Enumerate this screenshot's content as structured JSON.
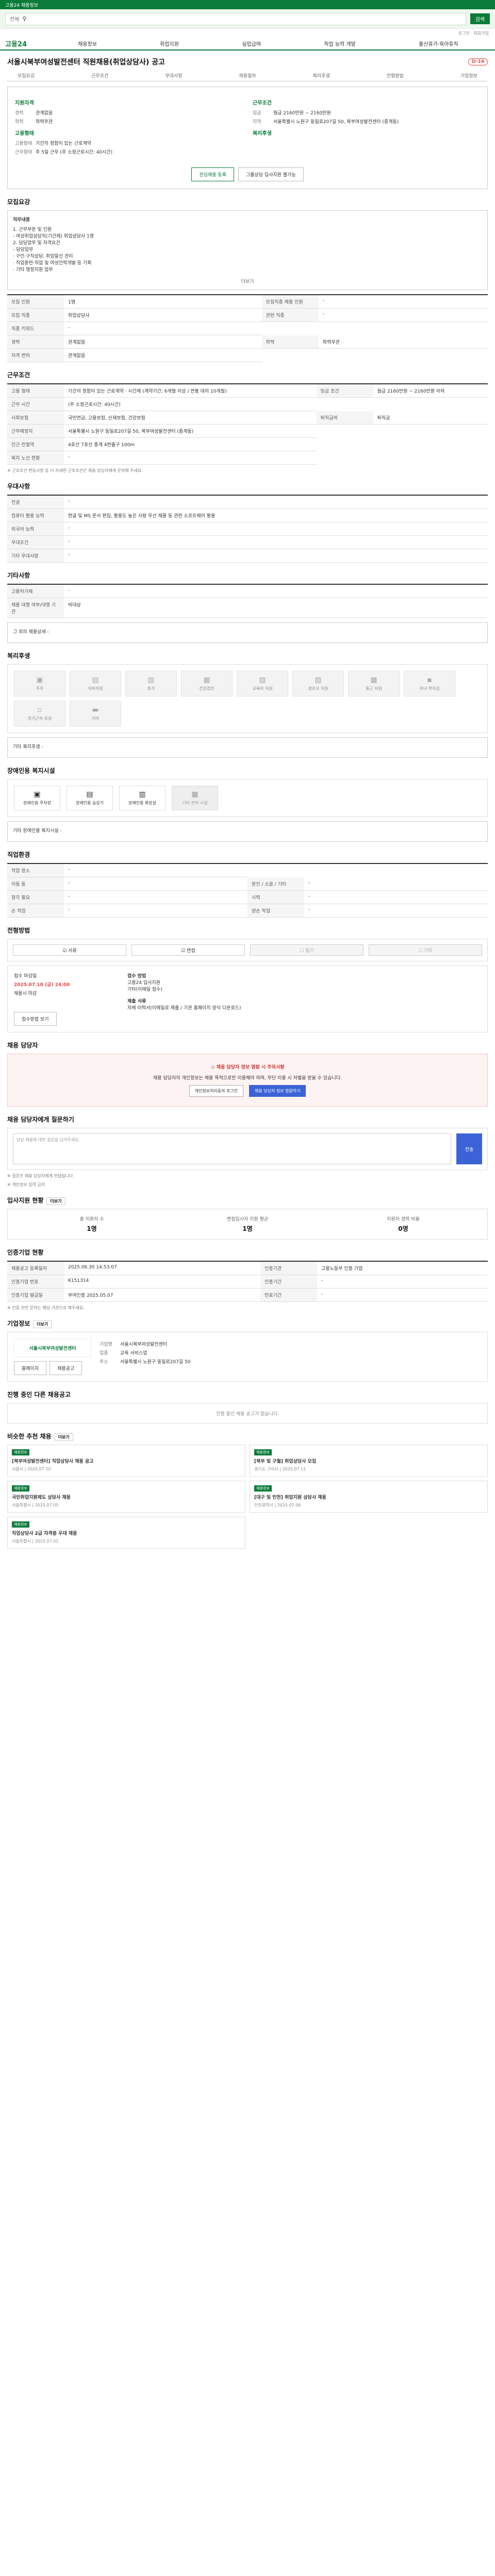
{
  "topbar": {
    "text": "고용24 채용정보"
  },
  "search": {
    "scope": "전체",
    "button": "검색"
  },
  "util": {
    "login": "로그인",
    "signup": "회원가입"
  },
  "gnb": {
    "logo": "고용24",
    "menu": [
      "채용정보",
      "취업지원",
      "실업급여",
      "직업 능력 개발",
      "출산휴가·육아휴직"
    ]
  },
  "page": {
    "title": "서울시북부여성발전센터 직원채용(취업상담사) 공고",
    "dday": "D-14"
  },
  "tabs": [
    "모집요강",
    "근무조건",
    "우대사항",
    "채용절차",
    "복리후생",
    "전형방법",
    "기업정보"
  ],
  "summary": {
    "left_h": "지원자격",
    "left": [
      [
        "경력",
        "관계없음"
      ],
      [
        "학력",
        "학력무관"
      ]
    ],
    "right_h": "근무조건",
    "right": [
      [
        "임금",
        "월급 2160만원 ~ 2160만원"
      ],
      [
        "지역",
        "서울특별시 노원구 동일로207길 50, 북부여성발전센터 (중계동)"
      ]
    ],
    "type_h": "고용형태",
    "type": [
      [
        "고용형태",
        "기간의 정함이 있는 근로계약"
      ],
      [
        "근무형태",
        "주 5일 근무 (주 소정근로시간: 40시간)"
      ]
    ],
    "benefit_h": "복리후생",
    "btn1": "관심채용 등록",
    "btn2": "그룹상담 입사지원 불가능"
  },
  "sec1": {
    "title": "모집요강",
    "duty_label": "직무내용",
    "duty_lines": [
      "1. 근무부문 및 인원",
      "- 여성취업상담직(기간제) 취업상담사 1명",
      "2. 담당업무 및 자격요건",
      "- 담당업무",
      "· 구인·구직상담, 취업알선 관리",
      "· 직업훈련·직업 및 여성인력개발 등 기획",
      "· 기타 행정지원 업무"
    ],
    "more": "더보기",
    "rows": [
      [
        "모집 인원",
        "1명",
        "모집직종 채용 인원",
        "-"
      ],
      [
        "모집 직종",
        "취업상담사",
        "관련 직종",
        "-"
      ],
      [
        "직종 키워드",
        "-",
        "",
        ""
      ],
      [
        "경력",
        "관계없음",
        "학력",
        "학력무관"
      ],
      [
        "자격 면허",
        "관계없음",
        "",
        ""
      ]
    ]
  },
  "sec2": {
    "title": "근무조건",
    "rows": [
      [
        "고용 형태",
        "기간의 정함이 있는 근로계약 · 시간제 (계약기간: 6개월 이상 / 연봉 대리 10개월)",
        "임금 조건",
        "월급 2160만원 ~ 2160만원 이하"
      ],
      [
        "근무 시간",
        "(주 소정근로시간: 40시간)",
        "",
        ""
      ],
      [
        "사회보험",
        "국민연금, 고용보험, 산재보험, 건강보험",
        "퇴직급여",
        "퇴직금"
      ],
      [
        "근무예정지",
        "서울특별시 노원구 동일로207길 50, 북부여성발전센터 (중계동)",
        "",
        ""
      ],
      [
        "인근 전철역",
        "4호선 7호선 중계 4번출구 100m",
        "",
        ""
      ],
      [
        "복지 노선 현황",
        "-",
        "",
        ""
      ]
    ],
    "note": "※ 근로조건 변동사항 등 더 자세한 근로조건은 채용 담당자에게 문의해 주세요."
  },
  "sec3": {
    "title": "우대사항",
    "rows": [
      [
        "전공",
        "-"
      ],
      [
        "컴퓨터 활용 능력",
        "한글 및 MS 문서 편집, 활용도 높은 사람 우선 채용 등 관련 소프트웨어 활용"
      ],
      [
        "외국어 능력",
        "-"
      ],
      [
        "우대조건",
        "-"
      ],
      [
        "기타 우대사항",
        "-"
      ]
    ]
  },
  "sec4": {
    "title": "기타사항",
    "rows": [
      [
        "고용허가제",
        "-"
      ],
      [
        "채용 대행 여부/대행 기관",
        "비대상"
      ]
    ],
    "extra": "그 외의 채용상세 -"
  },
  "sec5": {
    "title": "복리후생",
    "icons": [
      [
        "주차",
        "▣"
      ],
      [
        "식비지원",
        "▤"
      ],
      [
        "휴가",
        "▥"
      ],
      [
        "건강검진",
        "▦"
      ],
      [
        "교육비 지원",
        "▧"
      ],
      [
        "경조사 지원",
        "▨"
      ],
      [
        "통근 지원",
        "▩"
      ],
      [
        "자녀 학자금",
        "▪"
      ],
      [
        "장기근속 포상",
        "▫"
      ],
      [
        "기타",
        "▬"
      ]
    ],
    "extra": "기타 복리후생 -"
  },
  "sec6": {
    "title": "장애인용 복지시설",
    "items": [
      [
        "장애인용 주차장",
        "▣",
        true
      ],
      [
        "장애인용 승강기",
        "▤",
        true
      ],
      [
        "장애인용 화장실",
        "▥",
        true
      ],
      [
        "기타 편의 시설",
        "▦",
        false
      ]
    ],
    "extra": "기타 장애인용 복지시설 -"
  },
  "sec7": {
    "title": "직업환경",
    "rows": [
      [
        "작업 장소",
        "-",
        "",
        ""
      ],
      [
        "이동 동",
        "-",
        "분진 / 소음 / 기타",
        "-"
      ],
      [
        "청각 필요",
        "-",
        "시력",
        "-"
      ],
      [
        "손 작업",
        "-",
        "양손 작업",
        "-"
      ]
    ]
  },
  "sec8": {
    "title": "전형방법",
    "methods": [
      [
        "서류",
        true
      ],
      [
        "면접",
        true
      ],
      [
        "필기",
        false
      ],
      [
        "기타",
        false
      ]
    ],
    "rc_label1": "접수 마감일",
    "rc_date": "2025.07.18 (금) 24:00",
    "rc_sub": "채용시 마감",
    "rc_label2": "접수 방법",
    "rc_method": "고용24 입사지원",
    "rc_method2": "기타(이메일 접수)",
    "rc_doc_label": "제출 서류",
    "rc_docs": "자체 이력서(이메일로 제출 / 기관 홈페이지 양식 다운로드)",
    "rc_btn": "접수방법 보기"
  },
  "sec9": {
    "title": "채용 담당자",
    "warn": "채용 담당자 정보 열람 시 주의사항",
    "body": "채용 담당자의 개인정보는 채용 목적으로만 이용해야 하며, 무단 이용 시 처벌을 받을 수 있습니다.",
    "b1": "개인정보처리동의 로그인",
    "b2": "채용 담당자 정보 열람하기"
  },
  "sec10": {
    "title": "채용 담당자에게 질문하기",
    "placeholder": "담당 채용에 대한 질문을 남겨주세요.",
    "send": "전송",
    "notes": [
      "※ 질문은 채용 담당자에게 전달됩니다.",
      "※ 개인정보 입력 금지"
    ]
  },
  "sec11": {
    "title": "입사지원 현황",
    "more": "더보기",
    "stats": [
      [
        "총 지원자 수",
        "1명"
      ],
      [
        "면접입사자 지원 평균",
        "1명"
      ],
      [
        "지원자 경력 비율",
        "0명"
      ]
    ]
  },
  "sec12": {
    "title": "인증기업 현황",
    "rows": [
      [
        "채용공고 등록일자",
        "2025.06.30 14:53:07",
        "인증기관",
        "고용노동부 인증 기업"
      ],
      [
        "인증기업 번호",
        "K151314",
        "인증기간",
        "-"
      ],
      [
        "인증기업 발급일",
        "부여인증 2025.05.07",
        "만료기간",
        "-"
      ]
    ],
    "notes": [
      "※ 인증 관련 문의는 해당 기관으로 해주세요."
    ]
  },
  "sec13": {
    "title": "기업정보",
    "more": "더보기",
    "logo": "서울시북부여성발전센터",
    "rows": [
      [
        "기업명",
        "서울시북부여성발전센터"
      ],
      [
        "업종",
        "교육 서비스업"
      ],
      [
        "주소",
        "서울특별시 노원구 동일로207길 50"
      ]
    ],
    "btn1": "홈페이지",
    "btn2": "채용공고"
  },
  "sec14": {
    "title": "진행 중인 다른 채용공고",
    "empty": "진행 중인 채용 공고가 없습니다."
  },
  "sec15": {
    "title": "비슷한 추천 채용",
    "more": "더보기",
    "cards": [
      [
        "채용정보",
        "[북부여성발전센터] 직업상담사 채용 공고",
        "서울시",
        "2025.07.10"
      ],
      [
        "채용정보",
        "[북부 및 구월] 취업상담사 모집",
        "경기도 구리시",
        "2025.07.11"
      ],
      [
        "채용정보",
        "국민취업지원제도 상담사 채용",
        "서울특별시",
        "2025.07.05"
      ],
      [
        "채용정보",
        "[대구 및 인천] 취업지원 상담사 채용",
        "인천광역시",
        "2025.07.08"
      ],
      [
        "채용정보",
        "직업상담사 2급 자격증 우대 채용",
        "서울특별시",
        "2025.07.01"
      ]
    ]
  }
}
